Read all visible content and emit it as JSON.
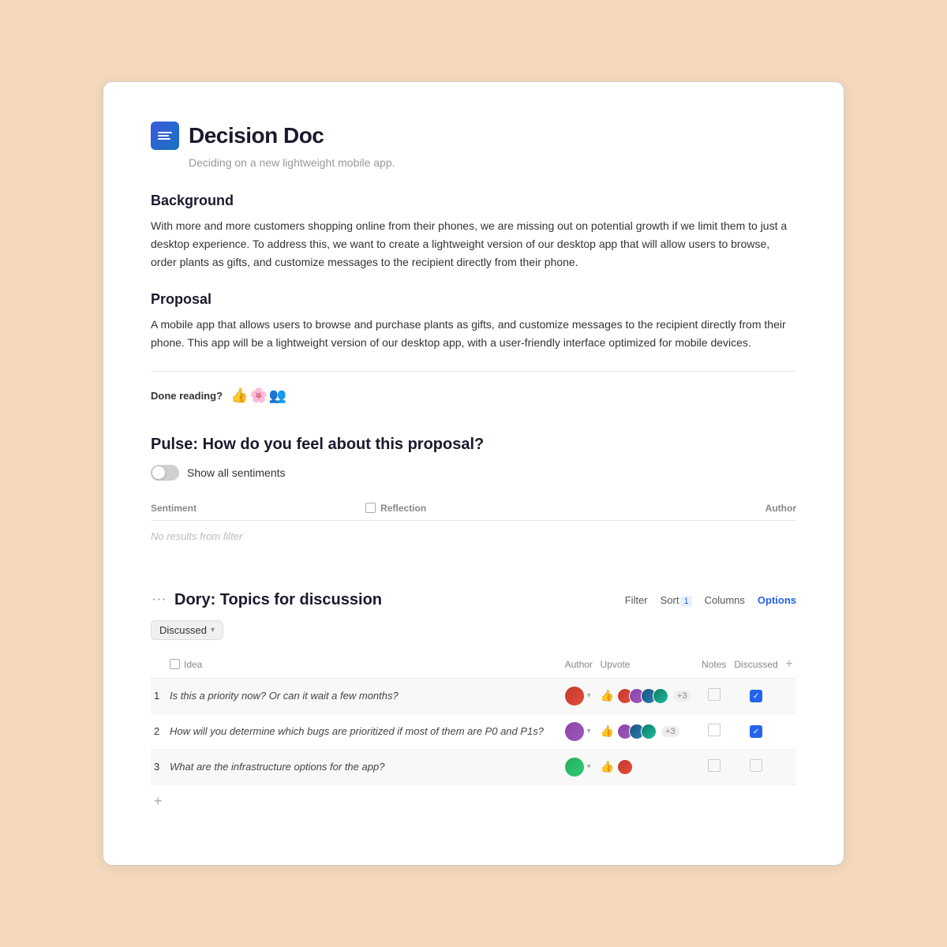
{
  "page": {
    "background_color": "#f5d9bc"
  },
  "doc": {
    "icon_label": "document icon",
    "title": "Decision Doc",
    "subtitle": "Deciding on a new lightweight mobile app."
  },
  "background_section": {
    "heading": "Background",
    "body": "With more and more customers shopping online from their phones, we are missing out on potential growth if we limit them to just a desktop experience. To address this, we want to create a lightweight version of our desktop app that will allow users to browse, order plants as gifts, and customize messages to the recipient directly from their phone."
  },
  "proposal_section": {
    "heading": "Proposal",
    "body": "A mobile app that allows users to browse and purchase plants as gifts, and customize messages to the recipient directly from their phone. This app will be a lightweight version of our desktop app, with a user-friendly interface optimized for mobile devices."
  },
  "done_reading": {
    "label": "Done reading?",
    "emojis": [
      "👍",
      "🌸",
      "👥"
    ]
  },
  "pulse": {
    "title": "Pulse: How do you feel about this proposal?",
    "toggle_label": "Show all sentiments",
    "columns": {
      "sentiment": "Sentiment",
      "reflection": "Reflection",
      "author": "Author"
    },
    "no_results": "No results from filter"
  },
  "dory": {
    "title": "Dory: Topics for discussion",
    "toolbar": {
      "filter_label": "Filter",
      "sort_label": "Sort",
      "sort_count": "1",
      "columns_label": "Columns",
      "options_label": "Options"
    },
    "filter_dropdown": {
      "label": "Discussed",
      "has_chevron": true
    },
    "columns": {
      "idea": "Idea",
      "author": "Author",
      "upvote": "Upvote",
      "notes": "Notes",
      "discussed": "Discussed",
      "add": "+"
    },
    "rows": [
      {
        "num": "1",
        "idea": "Is this a priority now? Or can it wait a few months?",
        "discussed": true
      },
      {
        "num": "2",
        "idea": "How will you determine which bugs are prioritized if most of them are P0 and P1s?",
        "discussed": true
      },
      {
        "num": "3",
        "idea": "What are the infrastructure options for the app?",
        "discussed": false
      }
    ]
  }
}
